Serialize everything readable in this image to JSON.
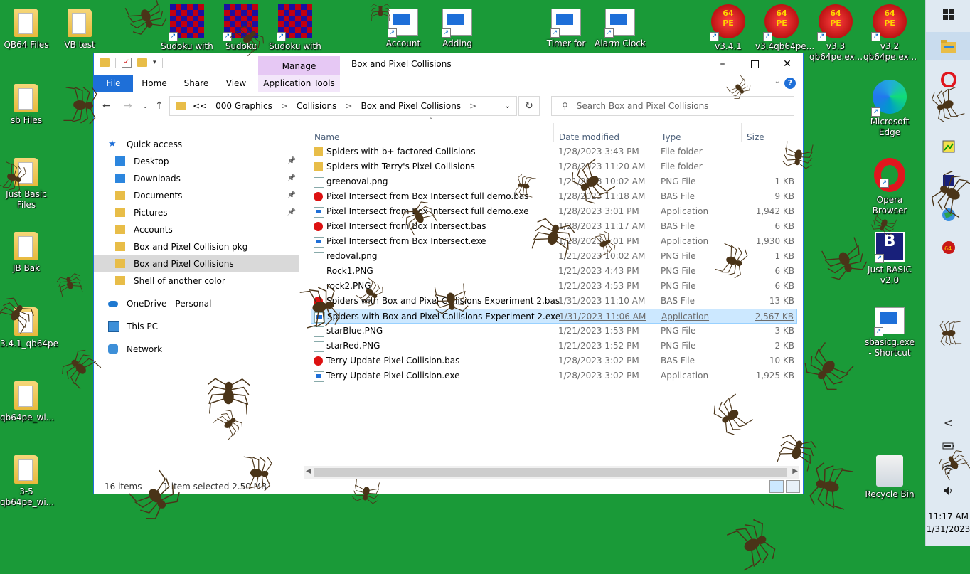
{
  "desktop": {
    "icons": [
      {
        "label": "QB64 Files",
        "kind": "folder"
      },
      {
        "label": "VB test",
        "kind": "folder"
      },
      {
        "label": "Sudoku with",
        "kind": "sudoku"
      },
      {
        "label": "Sudoku",
        "kind": "sudoku"
      },
      {
        "label": "Sudoku with",
        "kind": "sudoku"
      },
      {
        "label": "Account",
        "kind": "app"
      },
      {
        "label": "Adding",
        "kind": "app"
      },
      {
        "label": "Timer for",
        "kind": "app"
      },
      {
        "label": "Alarm Clock",
        "kind": "app"
      },
      {
        "label": "v3.4.1",
        "kind": "qb"
      },
      {
        "label": "v3.4qb64pe...",
        "kind": "qb"
      },
      {
        "label": "v3.3 qb64pe.ex...",
        "kind": "qb"
      },
      {
        "label": "v3.2 qb64pe.ex...",
        "kind": "qb"
      },
      {
        "label": "sb Files",
        "kind": "folder"
      },
      {
        "label": "Just Basic Files",
        "kind": "folder"
      },
      {
        "label": "JB Bak",
        "kind": "folder"
      },
      {
        "label": "3.4.1_qb64pe",
        "kind": "folder"
      },
      {
        "label": "qb64pe_wi...",
        "kind": "folder"
      },
      {
        "label": "3-5 qb64pe_wi...",
        "kind": "folder"
      },
      {
        "label": "Microsoft Edge",
        "kind": "edge"
      },
      {
        "label": "Opera Browser",
        "kind": "opera"
      },
      {
        "label": "Just BASIC v2.0",
        "kind": "jb"
      },
      {
        "label": "sbasicg.exe - Shortcut",
        "kind": "app"
      },
      {
        "label": "Recycle Bin",
        "kind": "bin"
      }
    ]
  },
  "taskbar": {
    "time": "11:17 AM",
    "date": "1/31/2023",
    "chevron": "<"
  },
  "explorer": {
    "title": "Box and Pixel Collisions",
    "manage_tab": "Manage",
    "ribbon_tabs": [
      "File",
      "Home",
      "Share",
      "View",
      "Application Tools"
    ],
    "breadcrumb": [
      "<<",
      "000 Graphics",
      ">",
      "Collisions",
      ">",
      "Box and Pixel Collisions",
      ">"
    ],
    "search_placeholder": "Search Box and Pixel Collisions",
    "nav": [
      {
        "label": "Quick access",
        "icon": "star",
        "pinned": false
      },
      {
        "label": "Desktop",
        "icon": "blue",
        "pinned": true
      },
      {
        "label": "Downloads",
        "icon": "blue",
        "pinned": true
      },
      {
        "label": "Documents",
        "icon": "folder",
        "pinned": true
      },
      {
        "label": "Pictures",
        "icon": "folder",
        "pinned": true
      },
      {
        "label": "Accounts",
        "icon": "folder",
        "pinned": false
      },
      {
        "label": "Box and Pixel Collision pkg",
        "icon": "folder",
        "pinned": false
      },
      {
        "label": "Box and Pixel Collisions",
        "icon": "folder",
        "pinned": false,
        "selected": true
      },
      {
        "label": "Shell of another color",
        "icon": "folder",
        "pinned": false
      },
      {
        "label": "OneDrive - Personal",
        "icon": "cloud",
        "pinned": false
      },
      {
        "label": "This PC",
        "icon": "pc",
        "pinned": false
      },
      {
        "label": "Network",
        "icon": "net",
        "pinned": false
      }
    ],
    "columns": [
      "Name",
      "Date modified",
      "Type",
      "Size"
    ],
    "files": [
      {
        "name": "Spiders with b+ factored Collisions",
        "date": "1/28/2023 3:43 PM",
        "type": "File folder",
        "size": "",
        "icon": "folder"
      },
      {
        "name": "Spiders with Terry's Pixel Collisions",
        "date": "1/28/2023 11:20 AM",
        "type": "File folder",
        "size": "",
        "icon": "folder"
      },
      {
        "name": "greenoval.png",
        "date": "1/21/2023 10:02 AM",
        "type": "PNG File",
        "size": "1 KB",
        "icon": "png"
      },
      {
        "name": "Pixel Intersect from Box Intersect full demo.bas",
        "date": "1/28/2023 11:18 AM",
        "type": "BAS File",
        "size": "9 KB",
        "icon": "bas"
      },
      {
        "name": "Pixel Intersect from Box Intersect full demo.exe",
        "date": "1/28/2023 3:01 PM",
        "type": "Application",
        "size": "1,942 KB",
        "icon": "exe"
      },
      {
        "name": "Pixel Intersect from Box Intersect.bas",
        "date": "1/28/2023 11:17 AM",
        "type": "BAS File",
        "size": "6 KB",
        "icon": "bas"
      },
      {
        "name": "Pixel Intersect from Box Intersect.exe",
        "date": "1/28/2023 3:01 PM",
        "type": "Application",
        "size": "1,930 KB",
        "icon": "exe"
      },
      {
        "name": "redoval.png",
        "date": "1/21/2023 10:02 AM",
        "type": "PNG File",
        "size": "1 KB",
        "icon": "png"
      },
      {
        "name": "Rock1.PNG",
        "date": "1/21/2023 4:43 PM",
        "type": "PNG File",
        "size": "6 KB",
        "icon": "png"
      },
      {
        "name": "rock2.PNG",
        "date": "1/21/2023 4:53 PM",
        "type": "PNG File",
        "size": "6 KB",
        "icon": "png"
      },
      {
        "name": "Spiders with Box and Pixel Collisions Experiment 2.bas",
        "date": "1/31/2023 11:10 AM",
        "type": "BAS File",
        "size": "13 KB",
        "icon": "bas"
      },
      {
        "name": "Spiders with Box and Pixel Collisions Experiment 2.exe",
        "date": "1/31/2023 11:06 AM",
        "type": "Application",
        "size": "2,567 KB",
        "icon": "exe",
        "selected": true
      },
      {
        "name": "starBlue.PNG",
        "date": "1/21/2023 1:53 PM",
        "type": "PNG File",
        "size": "3 KB",
        "icon": "png"
      },
      {
        "name": "starRed.PNG",
        "date": "1/21/2023 1:52 PM",
        "type": "PNG File",
        "size": "2 KB",
        "icon": "png"
      },
      {
        "name": "Terry Update Pixel Collision.bas",
        "date": "1/28/2023 3:02 PM",
        "type": "BAS File",
        "size": "10 KB",
        "icon": "bas"
      },
      {
        "name": "Terry Update Pixel Collision.exe",
        "date": "1/28/2023 3:02 PM",
        "type": "Application",
        "size": "1,925 KB",
        "icon": "exe"
      }
    ],
    "status_count": "16 items",
    "status_selected": "1 item selected  2.50 MB"
  },
  "colors": {
    "desktop": "#1a9a38",
    "accent": "#1e6fd8",
    "selection": "#cce8ff",
    "spider": "#4a3418"
  }
}
